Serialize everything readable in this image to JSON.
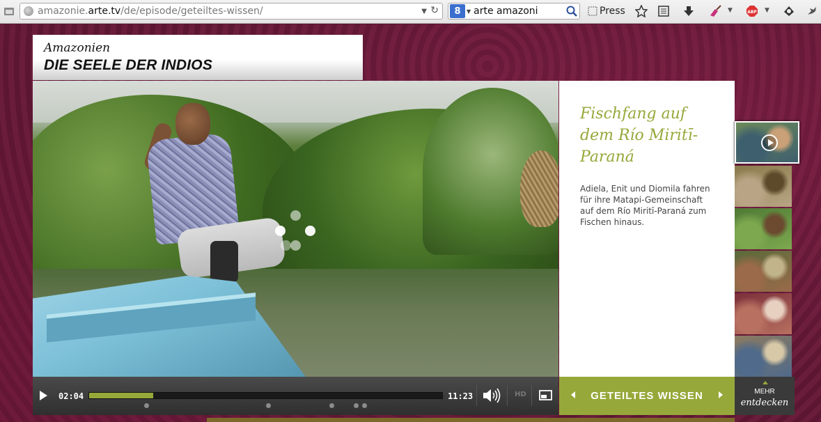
{
  "browser": {
    "url_prefix": "amazonie.",
    "url_domain": "arte.tv",
    "url_path": "/de/episode/geteiltes-wissen/",
    "search_engine_label": "8",
    "search_query": "arte amazoni",
    "press_label": "Press",
    "abp_label": "ABP"
  },
  "header": {
    "subtitle": "Amazonien",
    "title": "DIE SEELE DER INDIOS"
  },
  "video": {
    "current_time": "02:04",
    "duration": "11:23",
    "progress_fraction": 0.182,
    "chapter_marks": [
      0.163,
      0.507,
      0.685,
      0.755,
      0.778
    ],
    "hd_label": "HD"
  },
  "info": {
    "heading": "Fischfang auf dem Río Miritī-Paraná",
    "text": "Adiela, Enit und Diomila fahren für ihre Matapi-Gemeinschaft auf dem Río Miritī-Paraná zum Fischen hinaus."
  },
  "episode_nav": {
    "label": "GETEILTES WISSEN"
  },
  "more": {
    "line1": "MEHR",
    "line2": "entdecken"
  },
  "thumbnails": [
    {
      "colors": [
        "#6b8a5a",
        "#3e5f6e",
        "#c9a077"
      ]
    },
    {
      "colors": [
        "#8a7a4a",
        "#b9a585",
        "#5c4a2a"
      ]
    },
    {
      "colors": [
        "#4f7a35",
        "#7da84f",
        "#6b4a30"
      ]
    },
    {
      "colors": [
        "#5a6a3a",
        "#9a6a4a",
        "#c2b48a"
      ]
    },
    {
      "colors": [
        "#7a2f3a",
        "#b87060",
        "#e8d0c0"
      ]
    },
    {
      "colors": [
        "#8c7a60",
        "#4f6a8a",
        "#d7c8a8"
      ]
    }
  ],
  "colors": {
    "accent": "#97a83a",
    "background": "#5a1630"
  }
}
